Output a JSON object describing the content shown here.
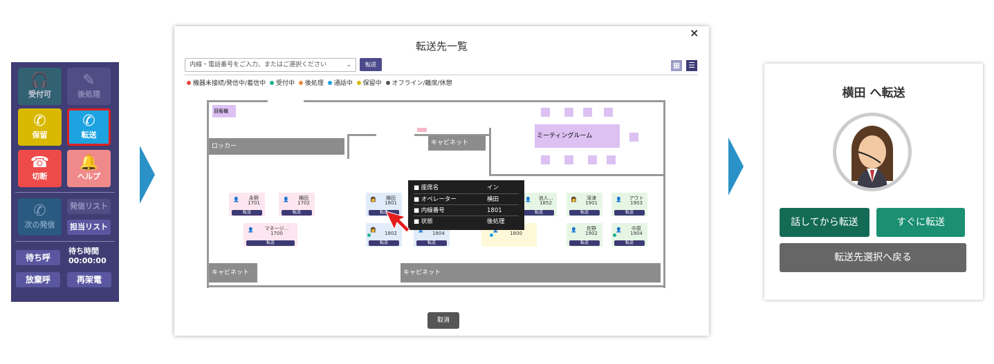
{
  "phone": {
    "buttons": [
      {
        "label": "受付可",
        "icon": "headset-icon",
        "color": "#2d6e74"
      },
      {
        "label": "後処理",
        "icon": "edit-icon",
        "color": "#4f4d83"
      },
      {
        "label": "保留",
        "icon": "phone-hold-icon",
        "color": "#d9b800"
      },
      {
        "label": "転送",
        "icon": "phone-transfer-icon",
        "color": "#1ca3e0"
      },
      {
        "label": "切断",
        "icon": "hangup-icon",
        "color": "#ee4a4a"
      },
      {
        "label": "ヘルプ",
        "icon": "bell-icon",
        "color": "#f08a8a"
      },
      {
        "label": "次の発信",
        "icon": "phone-call-icon",
        "color": "#2a5a80"
      }
    ],
    "call_list_label": "発信リスト",
    "assigned_list_label": "担当リスト",
    "wait_call_label": "待ち呼",
    "wait_time_label": "待ち時間",
    "wait_time_value": "00:00:00",
    "abandoned_label": "放棄呼",
    "redial_label": "再架電"
  },
  "dialog": {
    "title": "転送先一覧",
    "close_label": "×",
    "search_placeholder": "内線・電話番号をご入力、またはご選択ください",
    "transfer_button": "転送",
    "cancel_button": "取消",
    "legend": [
      {
        "label": "機器未接続/発信中/着信中",
        "color": "#e84545"
      },
      {
        "label": "受付中",
        "color": "#1bb38f"
      },
      {
        "label": "後処理",
        "color": "#f08a3a"
      },
      {
        "label": "通話中",
        "color": "#1ca3e0"
      },
      {
        "label": "保留中",
        "color": "#d9b800"
      },
      {
        "label": "オフライン/離席/休憩",
        "color": "#555555"
      }
    ],
    "floor": {
      "room_label": "目販機",
      "locker": "ロッカー",
      "cabinet": "キャビネット",
      "meeting": "ミーティングルーム",
      "seats": [
        {
          "name": "永野",
          "ext": "1701",
          "transfer": "転送"
        },
        {
          "name": "横田",
          "ext": "1702",
          "transfer": "転送"
        },
        {
          "name": "横田",
          "ext": "1801",
          "transfer": "転送"
        },
        {
          "name": "池人…",
          "ext": "1852",
          "transfer": "転送"
        },
        {
          "name": "深津",
          "ext": "1901",
          "transfer": "転送"
        },
        {
          "name": "アウト",
          "ext": "1903",
          "transfer": "転送"
        },
        {
          "name": "マネージ…",
          "ext": "1700",
          "transfer": "転送"
        },
        {
          "name": "",
          "ext": "1802",
          "transfer": "転送"
        },
        {
          "name": "",
          "ext": "1804",
          "transfer": "転送"
        },
        {
          "name": "",
          "ext": "1800",
          "transfer": ""
        },
        {
          "name": "佐野",
          "ext": "1902",
          "transfer": "転送"
        },
        {
          "name": "中原",
          "ext": "1904",
          "transfer": "転送"
        }
      ]
    },
    "tooltip": {
      "rows": [
        {
          "key": "■ 座席名",
          "value": "イン"
        },
        {
          "key": "■ オペレーター",
          "value": "横田"
        },
        {
          "key": "■ 内線番号",
          "value": "1801"
        },
        {
          "key": "■ 状態",
          "value": "後処理"
        }
      ]
    }
  },
  "confirm": {
    "title": "横田 へ転送",
    "talk_then_transfer": "話してから転送",
    "transfer_now": "すぐに転送",
    "back": "転送先選択へ戻る"
  }
}
